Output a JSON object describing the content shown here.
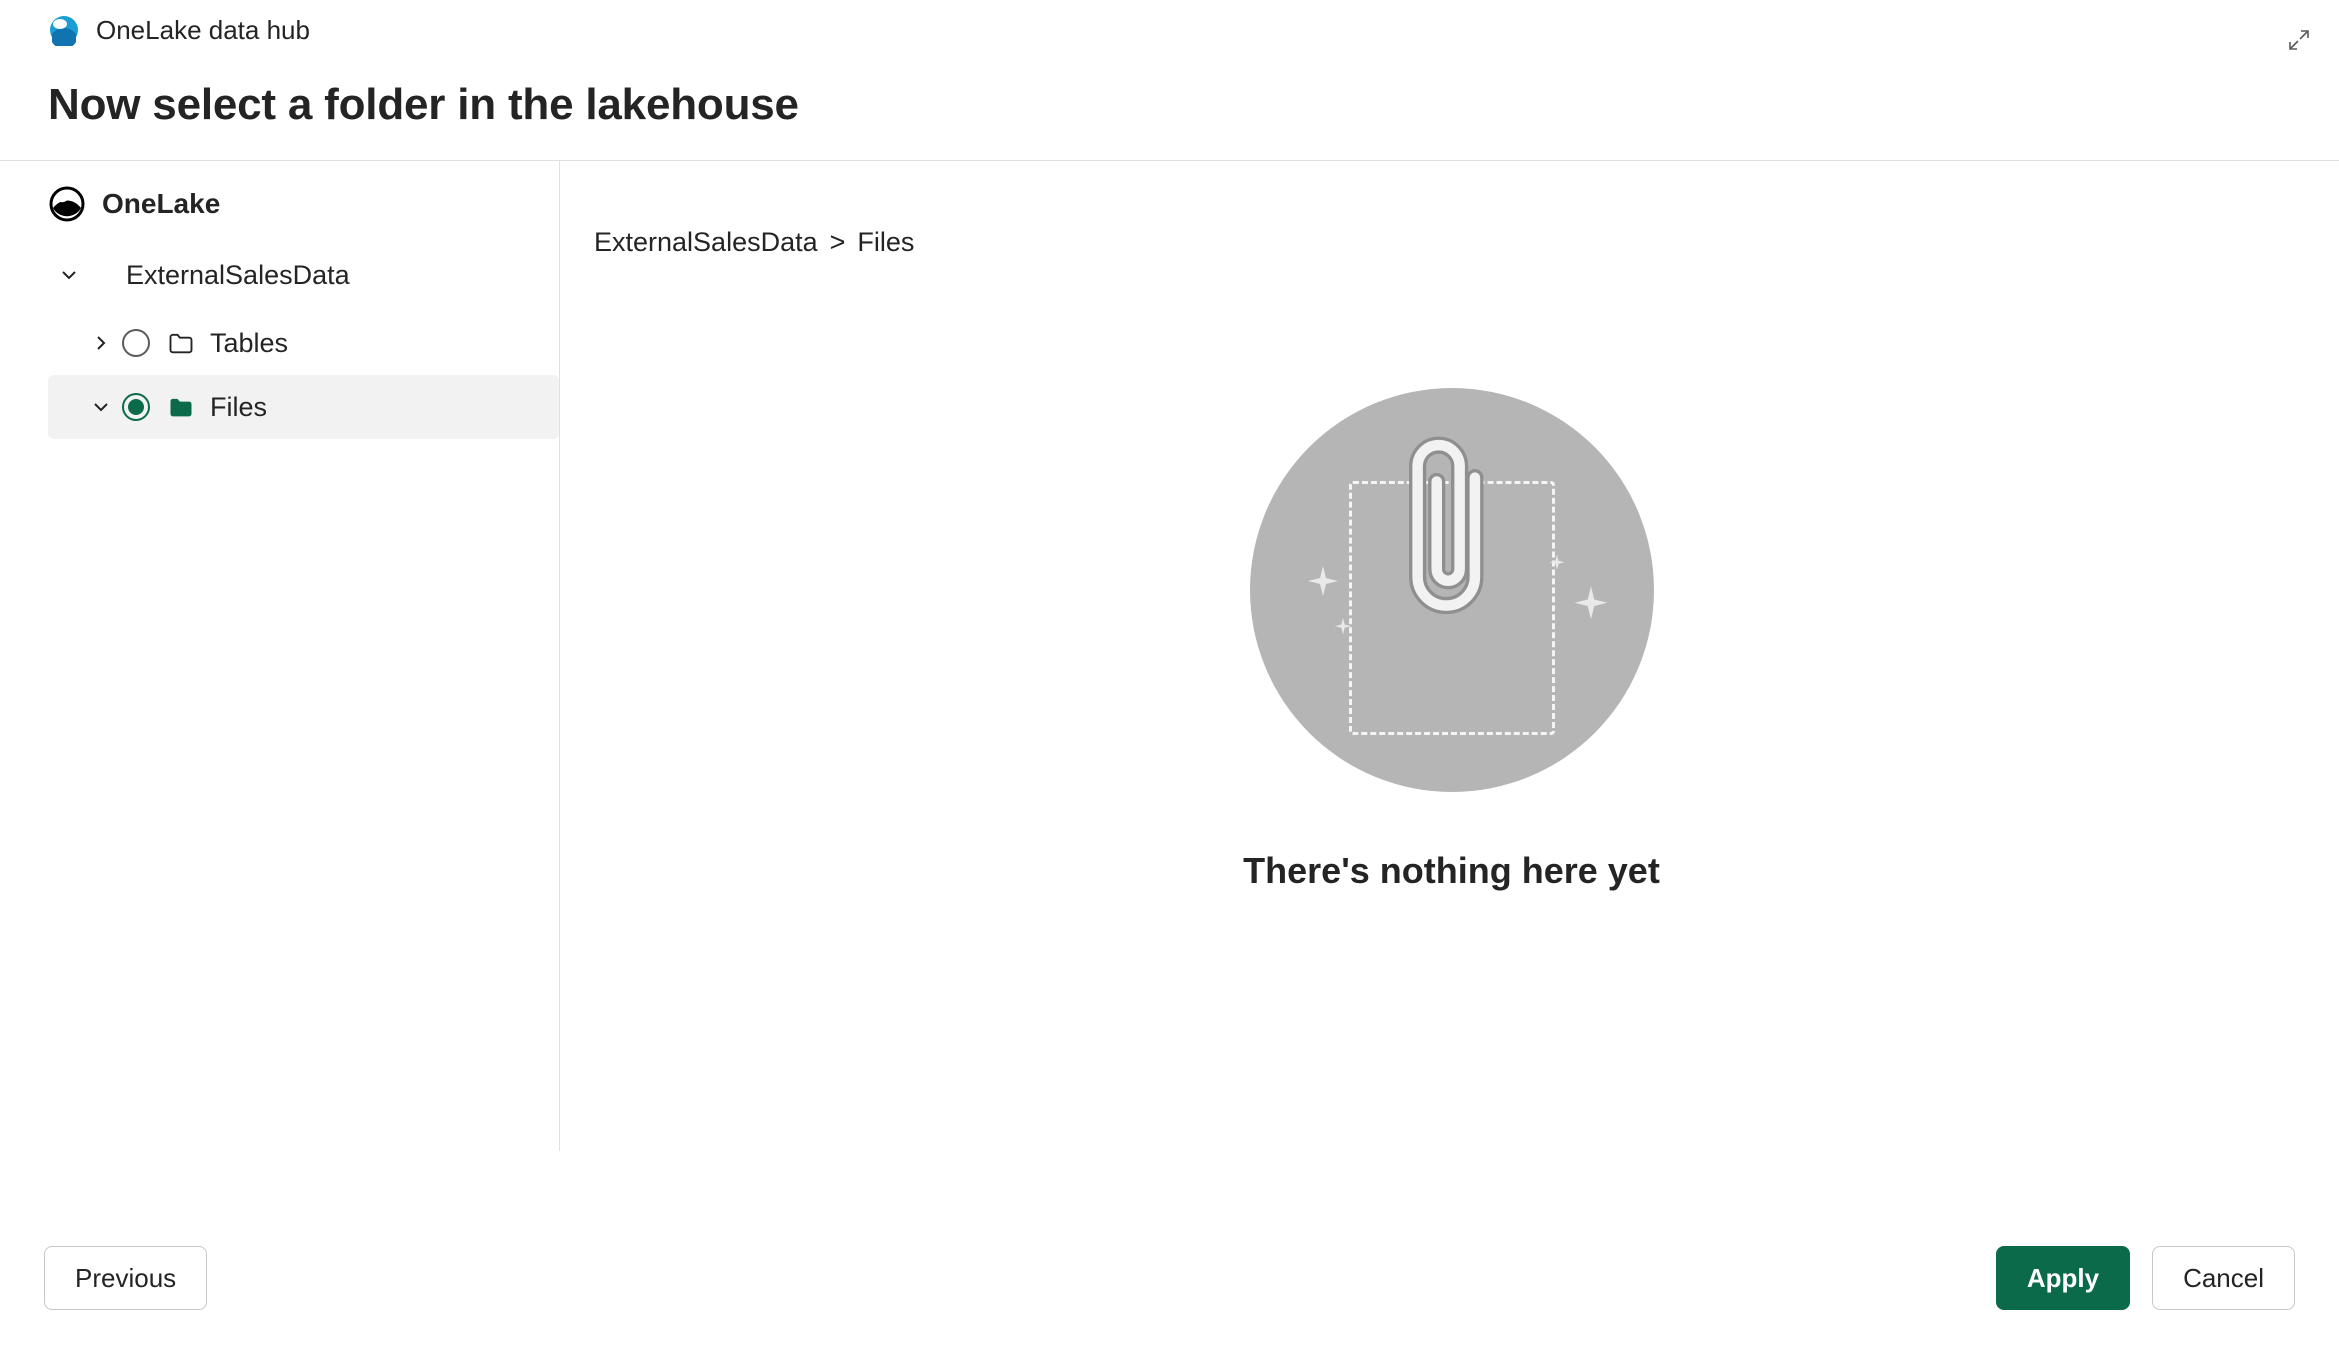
{
  "header": {
    "hub_title": "OneLake data hub",
    "page_title": "Now select a folder in the lakehouse"
  },
  "sidebar": {
    "root_label": "OneLake",
    "lakehouse_label": "ExternalSalesData",
    "items": [
      {
        "label": "Tables",
        "selected": false,
        "expanded": false
      },
      {
        "label": "Files",
        "selected": true,
        "expanded": true
      }
    ]
  },
  "breadcrumb": {
    "parts": [
      "ExternalSalesData",
      "Files"
    ],
    "separator": ">"
  },
  "empty_state": {
    "text": "There's nothing here yet"
  },
  "footer": {
    "previous": "Previous",
    "apply": "Apply",
    "cancel": "Cancel"
  },
  "colors": {
    "accent": "#0b6a4a",
    "divider": "#e0e0e0",
    "selected_bg": "#f2f2f2",
    "illustration_bg": "#b5b5b5"
  }
}
